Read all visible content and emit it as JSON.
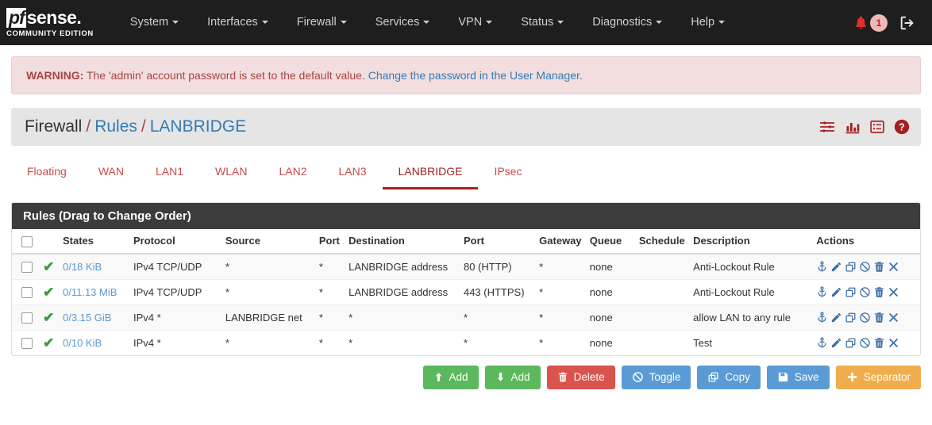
{
  "navbar": {
    "brand": {
      "pf": "pf",
      "sense": "sense.",
      "subtitle": "COMMUNITY EDITION"
    },
    "menus": [
      {
        "label": "System"
      },
      {
        "label": "Interfaces"
      },
      {
        "label": "Firewall"
      },
      {
        "label": "Services"
      },
      {
        "label": "VPN"
      },
      {
        "label": "Status"
      },
      {
        "label": "Diagnostics"
      },
      {
        "label": "Help"
      }
    ],
    "notification_count": "1",
    "notification_icon": "bell-icon",
    "logout_icon": "logout-icon"
  },
  "alert": {
    "prefix": "WARNING:",
    "message": "The 'admin' account password is set to the default value.",
    "link": "Change the password in the User Manager."
  },
  "breadcrumb": {
    "root": "Firewall",
    "sep": "/",
    "section": "Rules",
    "current": "LANBRIDGE",
    "icons": [
      "sliders-icon",
      "bar-chart-icon",
      "list-icon",
      "help-icon"
    ]
  },
  "tabs": [
    {
      "label": "Floating",
      "active": false
    },
    {
      "label": "WAN",
      "active": false
    },
    {
      "label": "LAN1",
      "active": false
    },
    {
      "label": "WLAN",
      "active": false
    },
    {
      "label": "LAN2",
      "active": false
    },
    {
      "label": "LAN3",
      "active": false
    },
    {
      "label": "LANBRIDGE",
      "active": true
    },
    {
      "label": "IPsec",
      "active": false
    }
  ],
  "panel": {
    "title": "Rules (Drag to Change Order)",
    "columns": [
      "",
      "States",
      "Protocol",
      "Source",
      "Port",
      "Destination",
      "Port",
      "Gateway",
      "Queue",
      "Schedule",
      "Description",
      "Actions"
    ],
    "row_action_icons": [
      "anchor-icon",
      "edit-icon",
      "copy-icon",
      "disable-icon",
      "delete-icon",
      "remove-icon"
    ],
    "rows": [
      {
        "states": "0/18 KiB",
        "protocol": "IPv4 TCP/UDP",
        "source": "*",
        "source_port": "*",
        "destination": "LANBRIDGE address",
        "dest_port": "80 (HTTP)",
        "gateway": "*",
        "queue": "none",
        "schedule": "",
        "description": "Anti-Lockout Rule"
      },
      {
        "states": "0/11.13 MiB",
        "protocol": "IPv4 TCP/UDP",
        "source": "*",
        "source_port": "*",
        "destination": "LANBRIDGE address",
        "dest_port": "443 (HTTPS)",
        "gateway": "*",
        "queue": "none",
        "schedule": "",
        "description": "Anti-Lockout Rule"
      },
      {
        "states": "0/3.15 GiB",
        "protocol": "IPv4 *",
        "source": "LANBRIDGE net",
        "source_port": "*",
        "destination": "*",
        "dest_port": "*",
        "gateway": "*",
        "queue": "none",
        "schedule": "",
        "description": "allow LAN to any rule"
      },
      {
        "states": "0/10 KiB",
        "protocol": "IPv4 *",
        "source": "*",
        "source_port": "*",
        "destination": "*",
        "dest_port": "*",
        "gateway": "*",
        "queue": "none",
        "schedule": "",
        "description": "Test"
      }
    ]
  },
  "buttons": [
    {
      "label": "Add",
      "icon": "arrow-up-icon",
      "color": "#5cb85c",
      "name": "add-up-button"
    },
    {
      "label": "Add",
      "icon": "arrow-down-icon",
      "color": "#5cb85c",
      "name": "add-down-button"
    },
    {
      "label": "Delete",
      "icon": "trash-icon",
      "color": "#d9534f",
      "name": "delete-button"
    },
    {
      "label": "Toggle",
      "icon": "ban-icon",
      "color": "#5b9bd5",
      "name": "toggle-button"
    },
    {
      "label": "Copy",
      "icon": "copy-icon",
      "color": "#5b9bd5",
      "name": "copy-button"
    },
    {
      "label": "Save",
      "icon": "save-icon",
      "color": "#5b9bd5",
      "name": "save-button"
    },
    {
      "label": "Separator",
      "icon": "plus-icon",
      "color": "#f0ad4e",
      "name": "separator-button"
    }
  ],
  "colors": {
    "navbar_bg": "#1e1e1e",
    "alert_bg": "#f2dede",
    "alert_text": "#a94442",
    "link": "#337ab7",
    "tab_active": "#a32020",
    "panel_head_bg": "#3c3c3c",
    "state_link": "#5b9bd5",
    "pass_tick": "#3c9a3c",
    "action_icon": "#3d6fa5"
  }
}
